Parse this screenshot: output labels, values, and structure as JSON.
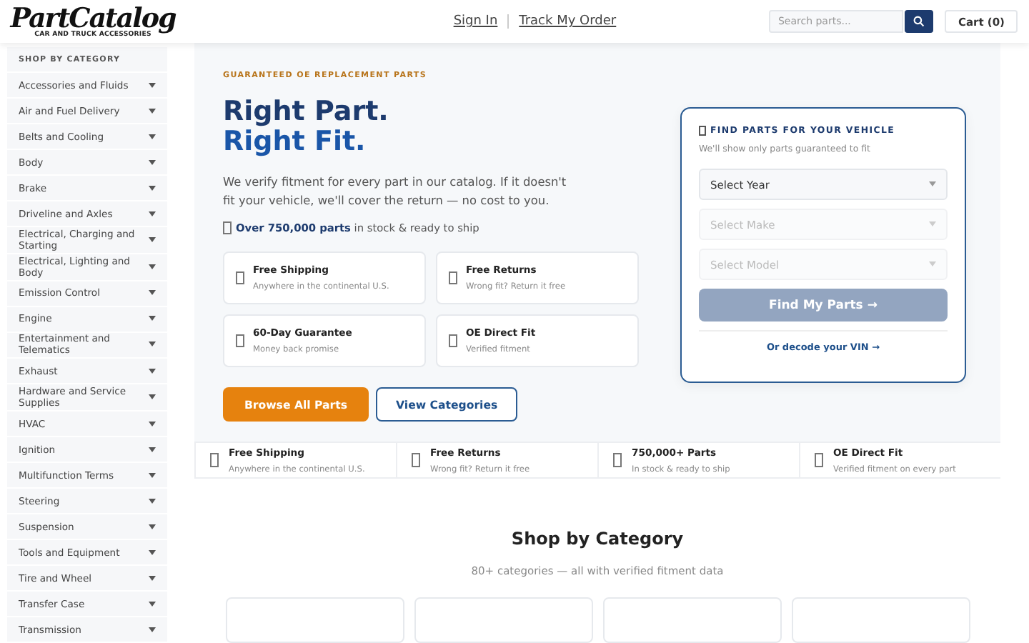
{
  "header": {
    "logo": "PartCatalog",
    "logo_tagline": "CAR AND TRUCK ACCESSORIES",
    "nav": [
      "Sign In",
      "Track My Order"
    ],
    "search": {
      "placeholder": "Search parts..."
    },
    "cart": "Cart (0)"
  },
  "sidebar": {
    "title": "SHOP BY CATEGORY",
    "items": [
      {
        "label": "Accessories and Fluids"
      },
      {
        "label": "Air and Fuel Delivery"
      },
      {
        "label": "Belts and Cooling"
      },
      {
        "label": "Body"
      },
      {
        "label": "Brake"
      },
      {
        "label": "Driveline and Axles"
      },
      {
        "label": "Electrical, Charging and Starting"
      },
      {
        "label": "Electrical, Lighting and Body"
      },
      {
        "label": "Emission Control"
      },
      {
        "label": "Engine"
      },
      {
        "label": "Entertainment and Telematics"
      },
      {
        "label": "Exhaust"
      },
      {
        "label": "Hardware and Service Supplies"
      },
      {
        "label": "HVAC"
      },
      {
        "label": "Ignition"
      },
      {
        "label": "Multifunction Terms"
      },
      {
        "label": "Steering"
      },
      {
        "label": "Suspension"
      },
      {
        "label": "Tools and Equipment"
      },
      {
        "label": "Tire and Wheel"
      },
      {
        "label": "Transfer Case"
      },
      {
        "label": "Transmission"
      }
    ]
  },
  "hero": {
    "eyebrow": "GUARANTEED OE REPLACEMENT PARTS",
    "title_line_1": "Right Part.",
    "title_line_2": "Right Fit.",
    "description": "We verify fitment for every part in our catalog. If it doesn't fit your vehicle, we'll cover the return — no cost to you.",
    "stock_note": "**Over 750,000 parts** in stock & ready to ship",
    "features": [
      {
        "title": "Free Shipping",
        "subtitle": "Anywhere in the continental U.S."
      },
      {
        "title": "Free Returns",
        "subtitle": "Wrong fit? Return it free"
      },
      {
        "title": "60-Day Guarantee",
        "subtitle": "Money back promise"
      },
      {
        "title": "OE Direct Fit",
        "subtitle": "Verified fitment"
      }
    ],
    "buttons": [
      {
        "label": "Browse All Parts",
        "kind": "primary"
      },
      {
        "label": "View Categories",
        "kind": "secondary"
      }
    ]
  },
  "finder": {
    "title": "FIND PARTS FOR YOUR VEHICLE",
    "subtitle": "We'll show only parts guaranteed to fit",
    "selects": [
      {
        "placeholder": "Select Year",
        "disabled": false
      },
      {
        "placeholder": "Select Make",
        "disabled": true
      },
      {
        "placeholder": "Select Model",
        "disabled": true
      }
    ],
    "button": {
      "label": "Find My Parts →",
      "disabled": true
    },
    "vin_link": "Or decode your VIN →"
  },
  "strip": [
    {
      "title": "Free Shipping",
      "subtitle": "Anywhere in the continental U.S."
    },
    {
      "title": "Free Returns",
      "subtitle": "Wrong fit? Return it free"
    },
    {
      "title": "750,000+ Parts",
      "subtitle": "In stock & ready to ship"
    },
    {
      "title": "OE Direct Fit",
      "subtitle": "Verified fitment on every part"
    }
  ],
  "categories": {
    "title": "Shop by Category",
    "subtitle": "80+ categories — all with verified fitment data",
    "cards": [
      {
        "kind": "blank"
      },
      {
        "kind": "blank"
      },
      {
        "kind": "blank"
      },
      {
        "kind": "blank"
      }
    ]
  }
}
